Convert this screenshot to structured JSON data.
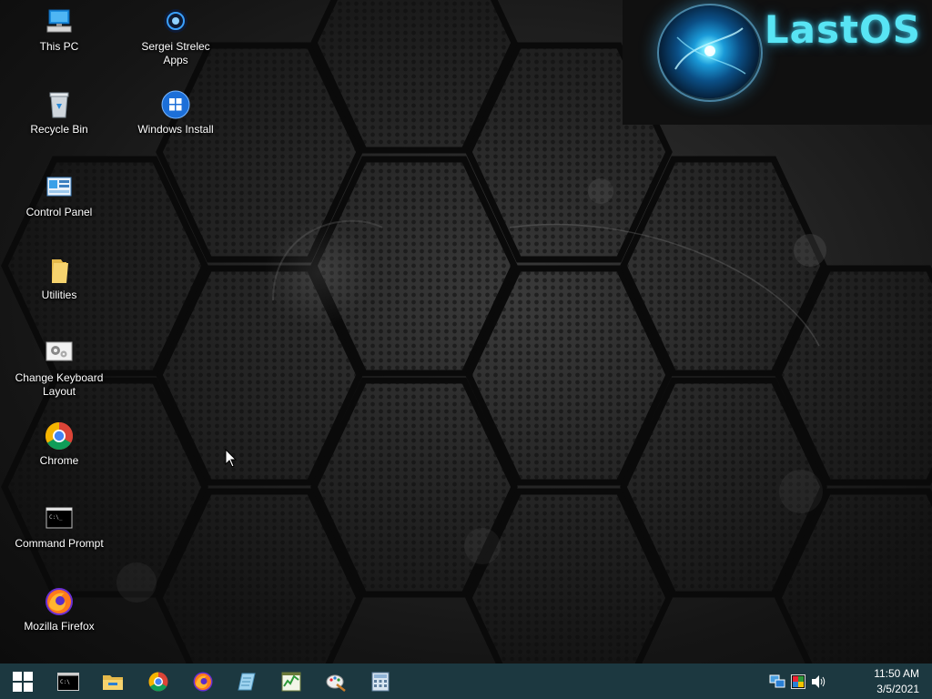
{
  "desktop": {
    "brand_text": "LastOS",
    "icons": [
      {
        "label": "This PC",
        "icon": "this-pc-icon"
      },
      {
        "label": "Sergei Strelec Apps",
        "icon": "strelec-apps-icon"
      },
      {
        "label": "Recycle Bin",
        "icon": "recycle-bin-icon"
      },
      {
        "label": "Windows Install",
        "icon": "windows-install-icon"
      },
      {
        "label": "Control Panel",
        "icon": "control-panel-icon"
      },
      {
        "label": "Utilities",
        "icon": "folder-icon"
      },
      {
        "label": "Change Keyboard Layout",
        "icon": "keyboard-layout-icon"
      },
      {
        "label": "Chrome",
        "icon": "chrome-icon"
      },
      {
        "label": "Command Prompt",
        "icon": "command-prompt-icon"
      },
      {
        "label": "Mozilla Firefox",
        "icon": "firefox-icon"
      }
    ]
  },
  "taskbar": {
    "pinned": [
      "start-icon",
      "command-prompt-icon",
      "file-explorer-icon",
      "chrome-icon",
      "firefox-icon",
      "notepad-icon",
      "task-manager-icon",
      "paint-icon",
      "calculator-icon"
    ],
    "tray": [
      "network-icon",
      "display-icon",
      "volume-icon"
    ],
    "time": "11:50 AM",
    "date": "3/5/2021"
  },
  "colors": {
    "taskbar_bg": "#1c3840",
    "brand_text": "#58e4f4"
  }
}
